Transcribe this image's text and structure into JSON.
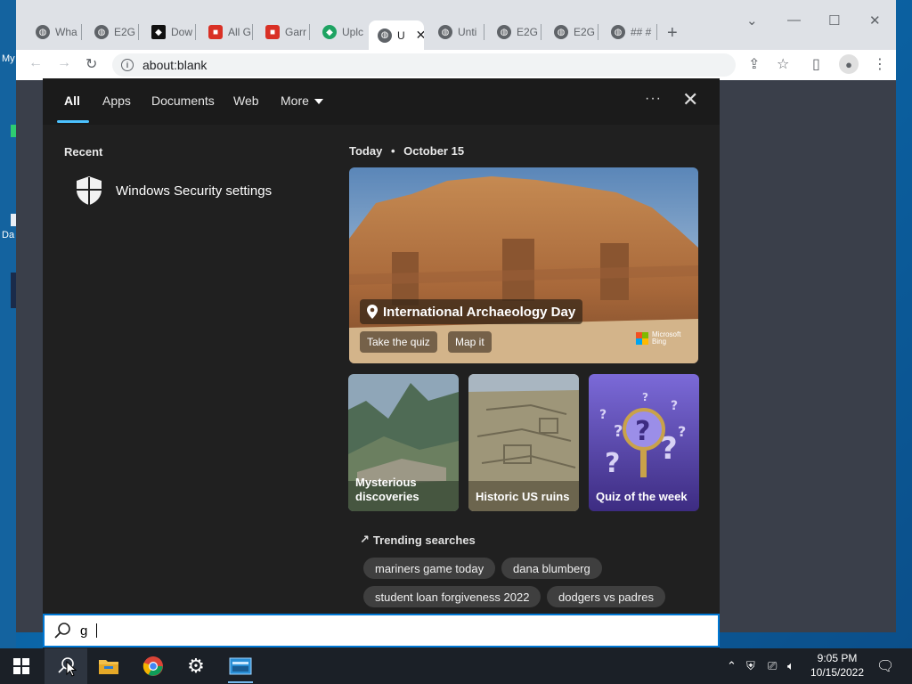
{
  "desktop": {
    "labels": [
      "My",
      "Da"
    ]
  },
  "browser": {
    "tabs": [
      {
        "label": "Wha",
        "favicon": "globe-icon"
      },
      {
        "label": "E2G",
        "favicon": "globe-icon"
      },
      {
        "label": "Dow",
        "favicon": "download-site-icon"
      },
      {
        "label": "All G",
        "favicon": "lock-icon"
      },
      {
        "label": "Garr",
        "favicon": "lock-icon"
      },
      {
        "label": "Uplc",
        "favicon": "upload-site-icon"
      },
      {
        "label": "U",
        "favicon": "globe-icon",
        "active": true
      },
      {
        "label": "Unti",
        "favicon": "globe-icon"
      },
      {
        "label": "E2G",
        "favicon": "globe-icon"
      },
      {
        "label": "E2G",
        "favicon": "globe-icon"
      },
      {
        "label": "## #",
        "favicon": "globe-icon"
      }
    ],
    "new_tab": "+",
    "address": "about:blank"
  },
  "search_panel": {
    "tabs": [
      "All",
      "Apps",
      "Documents",
      "Web",
      "More"
    ],
    "more_button": "···",
    "close_button": "✕",
    "recent": {
      "title": "Recent",
      "items": [
        {
          "label": "Windows Security settings",
          "icon": "shield-icon"
        }
      ]
    },
    "today": {
      "label": "Today",
      "separator": "•",
      "date": "October 15"
    },
    "hero": {
      "title": "International Archaeology Day",
      "buttons": [
        "Take the quiz",
        "Map it"
      ],
      "brand": [
        "Microsoft",
        "Bing"
      ]
    },
    "cards": [
      {
        "label": "Mysterious discoveries"
      },
      {
        "label": "Historic US ruins"
      },
      {
        "label": "Quiz of the week"
      }
    ],
    "trending": {
      "title": "Trending searches",
      "chips": [
        "mariners game today",
        "dana blumberg",
        "student loan forgiveness 2022",
        "dodgers vs padres"
      ]
    }
  },
  "search_box": {
    "value": "g"
  },
  "taskbar": {
    "time": "9:05 PM",
    "date": "10/15/2022"
  },
  "colors": {
    "accent": "#4cc2ff",
    "searchbox_border": "#0078d4",
    "panel_bg": "#202020"
  }
}
